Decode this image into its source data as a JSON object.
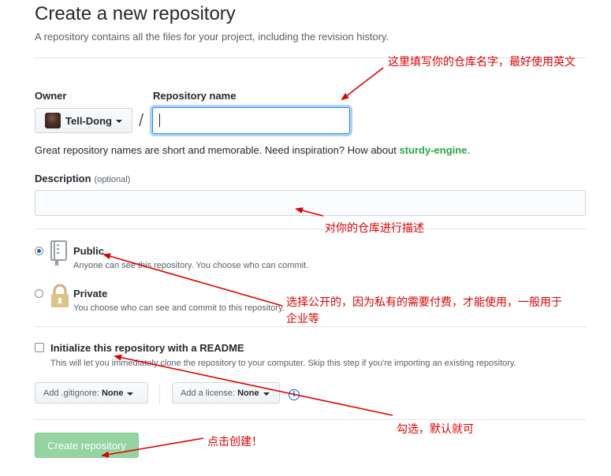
{
  "header": {
    "title": "Create a new repository",
    "subtitle": "A repository contains all the files for your project, including the revision history."
  },
  "owner": {
    "label": "Owner",
    "value": "Tell-Dong"
  },
  "repository_name": {
    "label": "Repository name",
    "value": "",
    "separator": "/"
  },
  "hint": {
    "text": "Great repository names are short and memorable. Need inspiration? How about",
    "suggestion": "sturdy-engine",
    "end": "."
  },
  "description": {
    "label": "Description",
    "optional": "(optional)",
    "value": ""
  },
  "visibility": {
    "public": {
      "label": "Public",
      "note": "Anyone can see this repository. You choose who can commit.",
      "selected": true
    },
    "private": {
      "label": "Private",
      "note": "You choose who can see and commit to this repository.",
      "selected": false
    }
  },
  "readme": {
    "label": "Initialize this repository with a README",
    "note": "This will let you immediately clone the repository to your computer. Skip this step if you're importing an existing repository.",
    "checked": false
  },
  "gitignore": {
    "label": "Add .gitignore:",
    "value": "None"
  },
  "license": {
    "label": "Add a license:",
    "value": "None"
  },
  "info_icon": "i",
  "create_button": {
    "label": "Create repository"
  },
  "annotations": {
    "name": "这里填写你的仓库名字，最好使用英文",
    "description": "对你的仓库进行描述",
    "visibility_line1": "选择公开的，因为私有的需要付费，才能使用，一般用于",
    "visibility_line2": "企业等",
    "readme": "勾选，默认就可",
    "create": "点击创建！"
  },
  "colors": {
    "annotation": "#e00000",
    "link_green": "#28a745",
    "button_green": "#94d3a2",
    "focus_blue": "#2188ff"
  }
}
